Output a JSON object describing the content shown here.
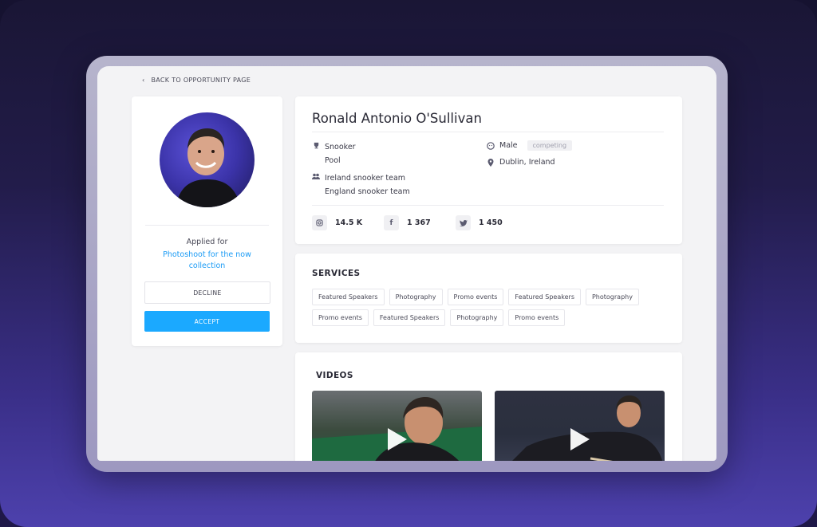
{
  "nav": {
    "back_label": "BACK TO OPPORTUNITY PAGE"
  },
  "profile": {
    "name": "Ronald Antonio O'Sullivan",
    "sports": [
      "Snooker",
      "Pool"
    ],
    "teams": [
      "Ireland snooker team",
      "England snooker team"
    ],
    "gender": "Male",
    "status_badge": "competing",
    "location": "Dublin, Ireland",
    "stats": {
      "instagram": "14.5 K",
      "facebook": "1 367",
      "twitter": "1 450"
    }
  },
  "application": {
    "applied_for_label": "Applied for",
    "opportunity_link": "Photoshoot for the now collection",
    "decline_label": "DECLINE",
    "accept_label": "ACCEPT"
  },
  "services": {
    "title": "SERVICES",
    "tags": [
      "Featured Speakers",
      "Photography",
      "Promo events",
      "Featured Speakers",
      "Photography",
      "Promo events",
      "Featured Speakers",
      "Photography",
      "Promo events"
    ]
  },
  "videos": {
    "title": "VIDEOS"
  },
  "colors": {
    "accent": "#1ba9ff",
    "link": "#1b9bf5"
  }
}
